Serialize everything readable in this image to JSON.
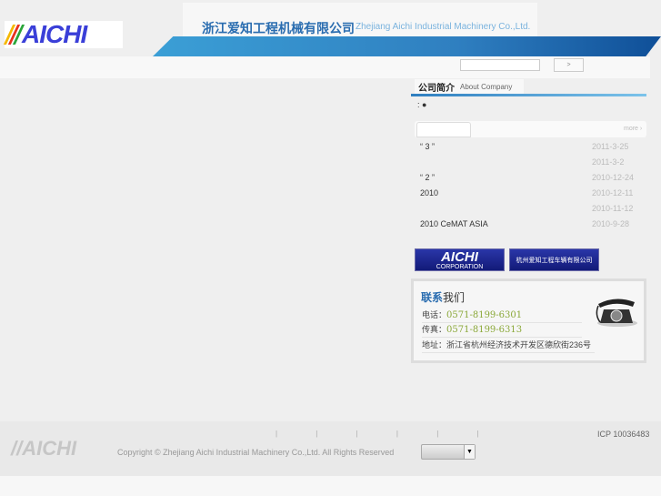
{
  "header": {
    "logo_text": "AICHI",
    "title_cn": "浙江爱知工程机械有限公司",
    "title_en": "Zhejiang Aichi Industrial Machinery Co.,Ltd.",
    "search_button": ">",
    "search_value": ""
  },
  "about": {
    "title_cn": "公司简介",
    "title_en": "About Company",
    "intro": ": ●"
  },
  "news": {
    "more": "more ›",
    "items": [
      {
        "title": "“ 3 ”",
        "date": "2011-3-25"
      },
      {
        "title": "",
        "date": "2011-3-2"
      },
      {
        "title": "“ 2 ”",
        "date": "2010-12-24"
      },
      {
        "title": "2010",
        "date": "2010-12-11"
      },
      {
        "title": "",
        "date": "2010-11-12"
      },
      {
        "title": "2010 CeMAT ASIA",
        "date": "2010-9-28"
      }
    ]
  },
  "banners": {
    "aichi_logo": "AICHI",
    "aichi_sub": "CORPORATION",
    "hangzhou": "杭州爱知工程车辆有限公司"
  },
  "contact": {
    "title_a": "联系",
    "title_b": "我们",
    "phone_label": "电话：",
    "phone": "0571-8199-6301",
    "fax_label": "传真：",
    "fax": "0571-8199-6313",
    "address": "地址：浙江省杭州经济技术开发区德欣街236号"
  },
  "footer": {
    "logo": "AICHI",
    "separators": "| | | | | |",
    "copyright": "Copyright © Zhejiang Aichi Industrial Machinery Co.,Ltd. All Rights Reserved",
    "icp": "ICP 10036483",
    "select_arrow": "▼"
  }
}
